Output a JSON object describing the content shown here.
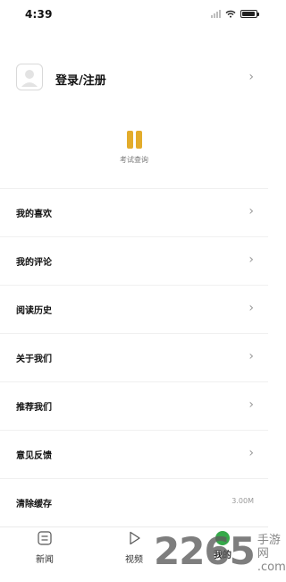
{
  "status_bar": {
    "time": "4:39"
  },
  "profile": {
    "login_label": "登录/注册"
  },
  "exam": {
    "label": "考试查询"
  },
  "menu": [
    {
      "label": "我的喜欢",
      "value": ""
    },
    {
      "label": "我的评论",
      "value": ""
    },
    {
      "label": "阅读历史",
      "value": ""
    },
    {
      "label": "关于我们",
      "value": ""
    },
    {
      "label": "推荐我们",
      "value": ""
    },
    {
      "label": "意见反馈",
      "value": ""
    },
    {
      "label": "清除缓存",
      "value": "3.00M"
    }
  ],
  "tabs": [
    {
      "label": "新闻"
    },
    {
      "label": "视频"
    },
    {
      "label": "我的"
    }
  ],
  "watermark": {
    "number": "2265",
    "text": "手游网",
    "suffix": ".com"
  },
  "colors": {
    "accent": "#36a94a",
    "exam_icon": "#e3ac2b"
  }
}
